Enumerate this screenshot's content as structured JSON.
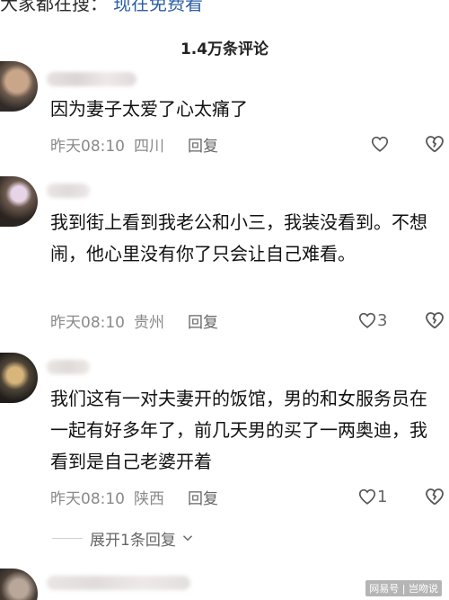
{
  "top": {
    "text": "大家都在搜：",
    "link": "现在免费看"
  },
  "header": {
    "comments_count": "1.4万条评论"
  },
  "comments": [
    {
      "text": "因为妻子太爱了心太痛了",
      "time": "昨天08:10",
      "location": "四川",
      "reply": "回复",
      "likes": ""
    },
    {
      "text": "我到街上看到我老公和小三，我装没看到。不想闹，他心里没有你了只会让自己难看。",
      "time": "昨天08:10",
      "location": "贵州",
      "reply": "回复",
      "likes": "3"
    },
    {
      "text": "我们这有一对夫妻开的饭馆，男的和女服务员在一起有好多年了，前几天男的买了一两奥迪，我看到是自己老婆开着",
      "time": "昨天08:10",
      "location": "陕西",
      "reply": "回复",
      "likes": "1"
    }
  ],
  "expand": {
    "label": "展开1条回复"
  },
  "watermark": "网易号 | 岂吻说",
  "icons": {
    "like": "heart-outline-icon",
    "dislike": "broken-heart-icon",
    "expand": "chevron-down-icon"
  },
  "colors": {
    "meta": "#8a8a8a",
    "link": "#2d5fa6"
  }
}
